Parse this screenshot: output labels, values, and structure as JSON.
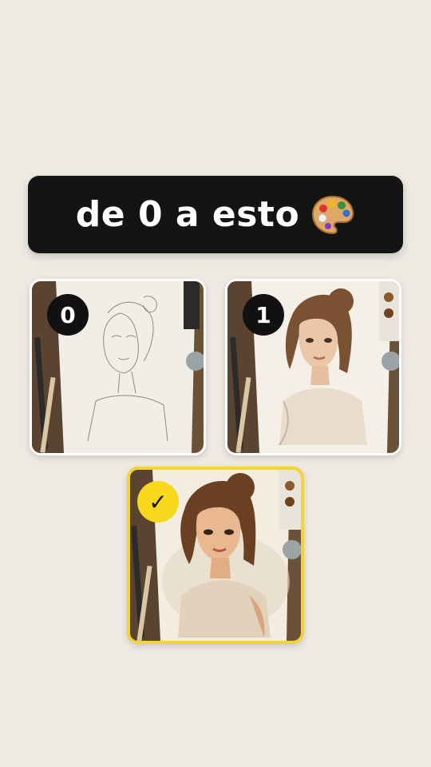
{
  "title": {
    "text": "de 0 a esto",
    "icon": "artist-palette-icon"
  },
  "cards": [
    {
      "badge": "0",
      "stage": "pencil sketch"
    },
    {
      "badge": "1",
      "stage": "partial color"
    },
    {
      "badge": "✓",
      "stage": "finished painting"
    }
  ],
  "colors": {
    "background": "#eee9e3",
    "banner": "#141414",
    "accent_yellow": "#f7d81c",
    "badge_dark": "#111111"
  }
}
